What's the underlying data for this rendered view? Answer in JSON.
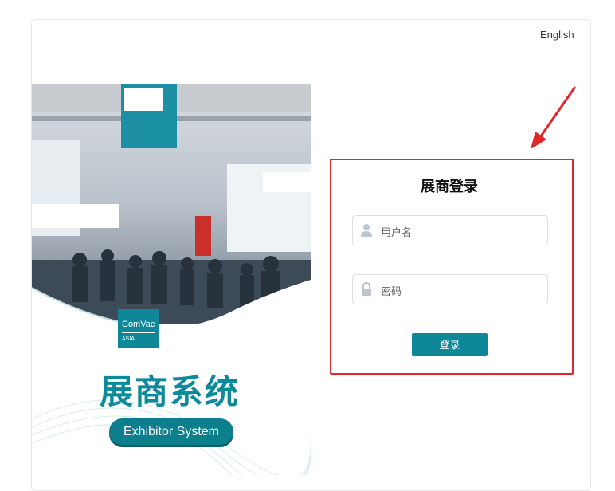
{
  "header": {
    "language_link": "English"
  },
  "poster": {
    "title_cn": "展商系统",
    "title_en": "Exhibitor System",
    "badge_top": "ComVac",
    "badge_bottom": "ASIA"
  },
  "login": {
    "title": "展商登录",
    "username_placeholder": "用户名",
    "password_placeholder": "密码",
    "submit_label": "登录"
  },
  "colors": {
    "accent": "#0e8798",
    "highlight_border": "#e0282b"
  }
}
